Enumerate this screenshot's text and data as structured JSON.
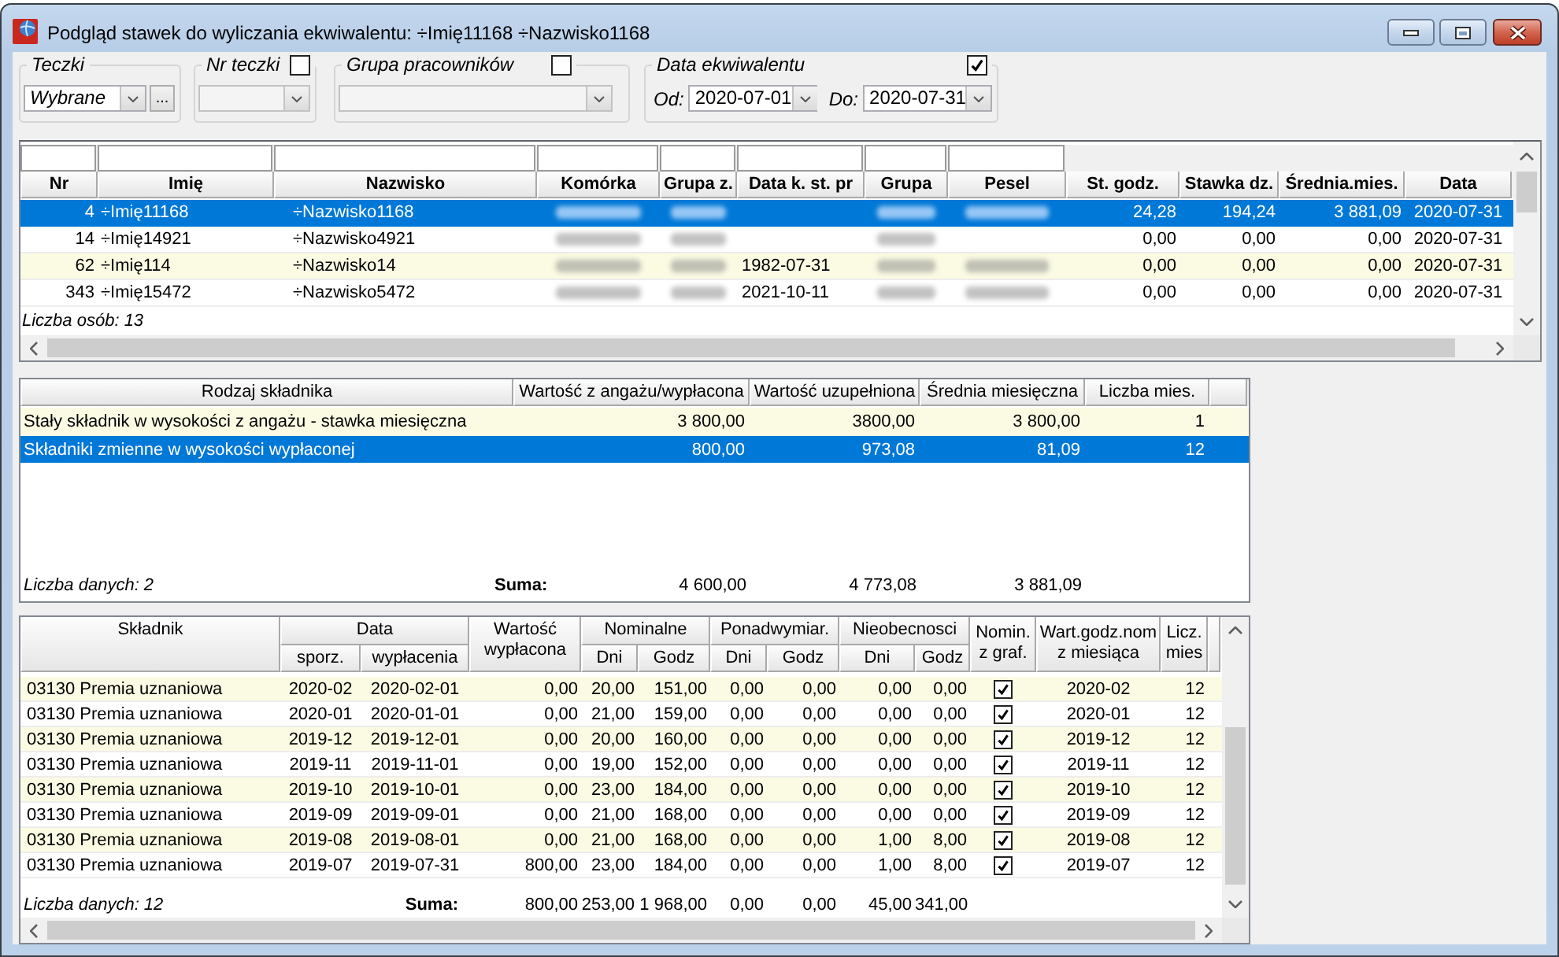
{
  "window": {
    "title": "Podgląd stawek do wyliczania ekwiwalentu: ÷Imię11168 ÷Nazwisko1168"
  },
  "filters": {
    "teczki": {
      "label": "Teczki",
      "value": "Wybrane",
      "button": "..."
    },
    "nr_teczki": {
      "label": "Nr teczki",
      "checked": false
    },
    "grupa": {
      "label": "Grupa pracowników",
      "checked": false
    },
    "data": {
      "label": "Data ekwiwalentu",
      "checked": true,
      "from_label": "Od:",
      "from": "2020-07-01",
      "to_label": "Do:",
      "to": "2020-07-31"
    }
  },
  "employees": {
    "columns": [
      {
        "label": "Nr",
        "filter": true
      },
      {
        "label": "Imię",
        "filter": true
      },
      {
        "label": "Nazwisko",
        "filter": true
      },
      {
        "label": "Komórka",
        "filter": true
      },
      {
        "label": "Grupa z.",
        "filter": true
      },
      {
        "label": "Data k. st. pr",
        "filter": true
      },
      {
        "label": "Grupa",
        "filter": true
      },
      {
        "label": "Pesel",
        "filter": true
      },
      {
        "label": "St. godz.",
        "filter": false
      },
      {
        "label": "Stawka dz.",
        "filter": false
      },
      {
        "label": "Średnia.mies.",
        "filter": false
      },
      {
        "label": "Data",
        "filter": false
      }
    ],
    "rows": [
      {
        "selected": true,
        "cells": [
          "4",
          "÷Imię11168",
          "÷Nazwisko1168",
          {
            "blurred": true
          },
          {
            "blurred": true
          },
          {
            "blurred": false
          },
          {
            "blurred": true
          },
          {
            "blurred": true
          },
          "24,28",
          "194,24",
          "3 881,09",
          "2020-07-31"
        ]
      },
      {
        "selected": false,
        "cells": [
          "14",
          "÷Imię14921",
          "÷Nazwisko4921",
          {
            "blurred": true
          },
          {
            "blurred": true
          },
          {
            "blurred": false
          },
          {
            "blurred": true
          },
          {
            "blurred": false
          },
          "0,00",
          "0,00",
          "0,00",
          "2020-07-31"
        ]
      },
      {
        "selected": false,
        "cells": [
          "62",
          "÷Imię114",
          "÷Nazwisko14",
          {
            "blurred": true
          },
          {
            "blurred": true
          },
          "1982-07-31",
          {
            "blurred": true
          },
          {
            "blurred": true
          },
          "0,00",
          "0,00",
          "0,00",
          "2020-07-31"
        ]
      },
      {
        "selected": false,
        "cells": [
          "343",
          "÷Imię15472",
          "÷Nazwisko5472",
          {
            "blurred": true
          },
          {
            "blurred": true
          },
          "2021-10-11",
          {
            "blurred": true
          },
          {
            "blurred": true
          },
          "0,00",
          "0,00",
          "0,00",
          "2020-07-31"
        ]
      }
    ],
    "footer": "Liczba osób: 13"
  },
  "components": {
    "columns": [
      "Rodzaj składnika",
      "Wartość z angażu/wypłacona",
      "Wartość uzupełniona",
      "Średnia miesięczna",
      "Liczba mies."
    ],
    "rows": [
      {
        "selected": false,
        "cells": [
          "Stały składnik w wysokości z angażu - stawka miesięczna",
          "3 800,00",
          "3800,00",
          "3 800,00",
          "1"
        ]
      },
      {
        "selected": true,
        "cells": [
          "Składniki zmienne w wysokości wypłaconej",
          "800,00",
          "973,08",
          "81,09",
          "12"
        ]
      }
    ],
    "footer": "Liczba danych: 2",
    "sum_label": "Suma:",
    "sums": [
      "4 600,00",
      "4 773,08",
      "3 881,09"
    ]
  },
  "details": {
    "columns": [
      {
        "label": "Składnik",
        "grouped": false
      },
      {
        "label": "sporz.",
        "group": "Data",
        "grouped": true
      },
      {
        "label": "wypłacenia",
        "grouped": true
      },
      {
        "label": "Wartość wypłacona",
        "grouped": false
      },
      {
        "label": "Dni",
        "group": "Nominalne",
        "grouped": true
      },
      {
        "label": "Godz",
        "grouped": true
      },
      {
        "label": "Dni",
        "group": "Ponadwymiar.",
        "grouped": true
      },
      {
        "label": "Godz",
        "grouped": true
      },
      {
        "label": "Dni",
        "group": "Nieobecnosci",
        "grouped": true
      },
      {
        "label": "Godz",
        "grouped": true
      },
      {
        "label": "Nomin. z graf.",
        "grouped": false
      },
      {
        "label": "Wart.godz.nom z miesiąca",
        "grouped": false
      },
      {
        "label": "Licz. mies",
        "grouped": false
      }
    ],
    "rows": [
      {
        "cells": [
          "03130 Premia uznaniowa",
          "2020-02",
          "2020-02-01",
          "0,00",
          "20,00",
          "151,00",
          "0,00",
          "0,00",
          "0,00",
          "0,00",
          {
            "checked": true
          },
          "2020-02",
          "12"
        ]
      },
      {
        "cells": [
          "03130 Premia uznaniowa",
          "2020-01",
          "2020-01-01",
          "0,00",
          "21,00",
          "159,00",
          "0,00",
          "0,00",
          "0,00",
          "0,00",
          {
            "checked": true
          },
          "2020-01",
          "12"
        ]
      },
      {
        "cells": [
          "03130 Premia uznaniowa",
          "2019-12",
          "2019-12-01",
          "0,00",
          "20,00",
          "160,00",
          "0,00",
          "0,00",
          "0,00",
          "0,00",
          {
            "checked": true
          },
          "2019-12",
          "12"
        ]
      },
      {
        "cells": [
          "03130 Premia uznaniowa",
          "2019-11",
          "2019-11-01",
          "0,00",
          "19,00",
          "152,00",
          "0,00",
          "0,00",
          "0,00",
          "0,00",
          {
            "checked": true
          },
          "2019-11",
          "12"
        ]
      },
      {
        "cells": [
          "03130 Premia uznaniowa",
          "2019-10",
          "2019-10-01",
          "0,00",
          "23,00",
          "184,00",
          "0,00",
          "0,00",
          "0,00",
          "0,00",
          {
            "checked": true
          },
          "2019-10",
          "12"
        ]
      },
      {
        "cells": [
          "03130 Premia uznaniowa",
          "2019-09",
          "2019-09-01",
          "0,00",
          "21,00",
          "168,00",
          "0,00",
          "0,00",
          "0,00",
          "0,00",
          {
            "checked": true
          },
          "2019-09",
          "12"
        ]
      },
      {
        "cells": [
          "03130 Premia uznaniowa",
          "2019-08",
          "2019-08-01",
          "0,00",
          "21,00",
          "168,00",
          "0,00",
          "0,00",
          "1,00",
          "8,00",
          {
            "checked": true
          },
          "2019-08",
          "12"
        ]
      },
      {
        "cells": [
          "03130 Premia uznaniowa",
          "2019-07",
          "2019-07-31",
          "800,00",
          "23,00",
          "184,00",
          "0,00",
          "0,00",
          "1,00",
          "8,00",
          {
            "checked": true
          },
          "2019-07",
          "12"
        ]
      }
    ],
    "footer": "Liczba danych: 12",
    "sum_label": "Suma:",
    "sums": [
      "800,00",
      "253,00",
      "1 968,00",
      "0,00",
      "0,00",
      "45,00",
      "341,00"
    ]
  }
}
